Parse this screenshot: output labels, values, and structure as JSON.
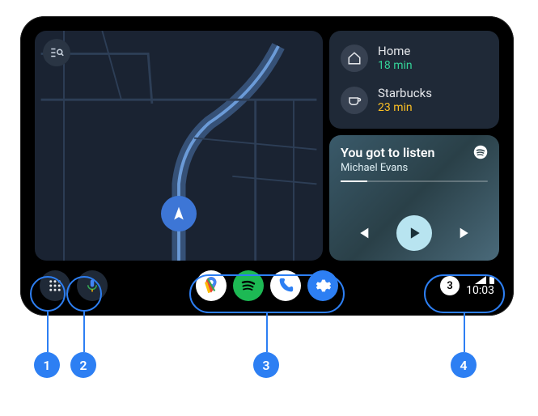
{
  "destinations": [
    {
      "icon": "home",
      "name": "Home",
      "time": "18 min",
      "timeClass": "time-green"
    },
    {
      "icon": "coffee",
      "name": "Starbucks",
      "time": "23 min",
      "timeClass": "time-yellow"
    }
  ],
  "media": {
    "title": "You got to listen",
    "artist": "Michael Evans",
    "provider": "spotify"
  },
  "navbar": {
    "apps": [
      "maps",
      "spotify",
      "phone",
      "settings"
    ],
    "notif_count": "3",
    "clock": "10:03"
  },
  "callouts": [
    "1",
    "2",
    "3",
    "4"
  ]
}
